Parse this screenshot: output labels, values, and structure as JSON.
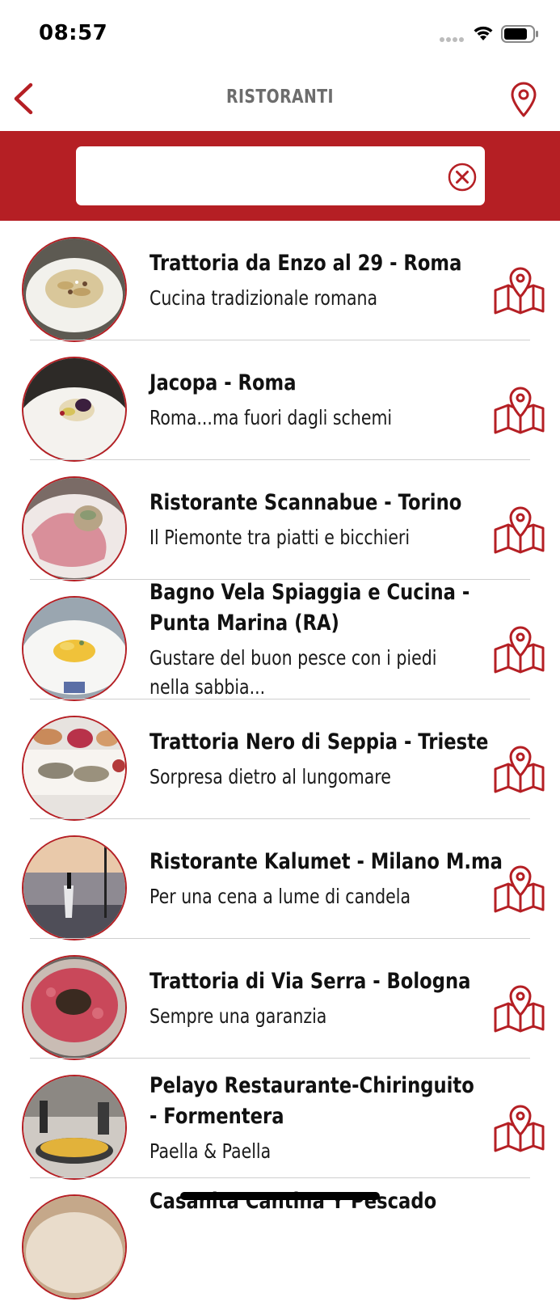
{
  "status_bar": {
    "time": "08:57",
    "icons": [
      "cellular-signal-icon",
      "wifi-icon",
      "battery-icon"
    ]
  },
  "nav": {
    "title": "RISTORANTI",
    "back_icon": "chevron-left-icon",
    "location_icon": "map-pin-icon"
  },
  "search": {
    "value": "",
    "placeholder": "",
    "clear_icon": "clear-circle-icon"
  },
  "colors": {
    "brand_red": "#b51f24",
    "title_gray": "#6d6d6d"
  },
  "restaurants": [
    {
      "line1": "Trattoria da Enzo al 29 - Roma",
      "line2": "",
      "desc1": "Cucina tradizionale romana",
      "desc2": "",
      "icon": "map-location-icon"
    },
    {
      "line1": "Jacopa - Roma",
      "line2": "",
      "desc1": "Roma...ma fuori dagli schemi",
      "desc2": "",
      "icon": "map-location-icon"
    },
    {
      "line1": "Ristorante Scannabue - Torino",
      "line2": "",
      "desc1": "Il Piemonte tra piatti e bicchieri",
      "desc2": "",
      "icon": "map-location-icon"
    },
    {
      "line1": "Bagno Vela Spiaggia e Cucina -",
      "line2": "Punta Marina (RA)",
      "desc1": "Gustare del buon pesce con i piedi",
      "desc2": "nella sabbia...",
      "icon": "map-location-icon"
    },
    {
      "line1": "Trattoria Nero di Seppia - Trieste",
      "line2": "",
      "desc1": "Sorpresa dietro al lungomare",
      "desc2": "",
      "icon": "map-location-icon"
    },
    {
      "line1": "Ristorante Kalumet - Milano M.ma",
      "line2": "",
      "desc1": "Per una cena a lume di candela",
      "desc2": "",
      "icon": "map-location-icon"
    },
    {
      "line1": "Trattoria di Via Serra - Bologna",
      "line2": "",
      "desc1": "Sempre una garanzia",
      "desc2": "",
      "icon": "map-location-icon"
    },
    {
      "line1": "Pelayo Restaurante-Chiringuito",
      "line2": "- Formentera",
      "desc1": "Paella & Paella",
      "desc2": "",
      "icon": "map-location-icon"
    },
    {
      "line1": "Casanita Cantina Y Pescado",
      "line2": "",
      "desc1": "",
      "desc2": "",
      "icon": "map-location-icon"
    }
  ]
}
